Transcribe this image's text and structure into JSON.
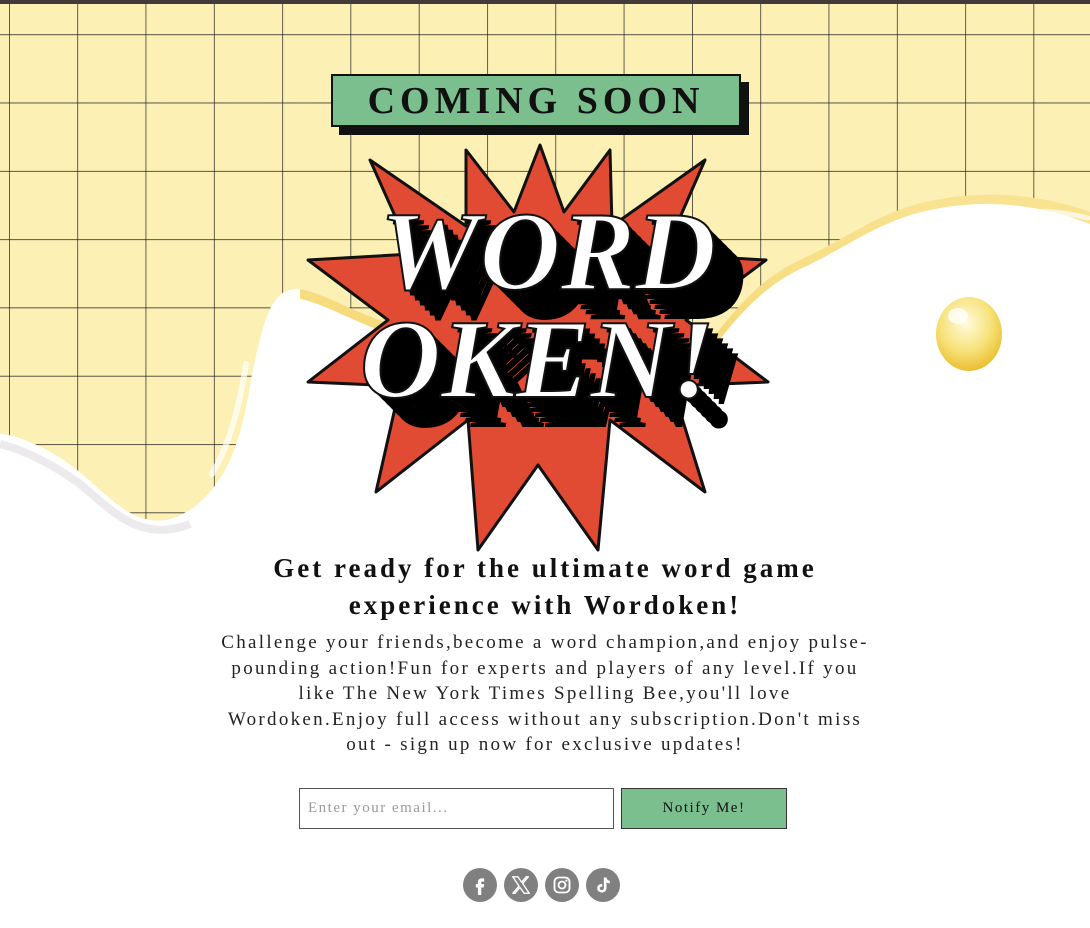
{
  "badge": {
    "label": "COMING SOON"
  },
  "logo": {
    "line1": "WORD",
    "line2": "OKEN!"
  },
  "headline": "Get ready for the ultimate word game experience with Wordoken!",
  "description": "Challenge your friends,become a word champion,and enjoy pulse-pounding action!Fun for experts and players of any level.If you like The New York Times Spelling Bee,you'll love Wordoken.Enjoy full access without any subscription.Don't miss out - sign up now for exclusive updates!",
  "signup": {
    "placeholder": "Enter your email...",
    "button_label": "Notify Me!"
  },
  "socials": [
    {
      "name": "facebook-icon"
    },
    {
      "name": "x-icon"
    },
    {
      "name": "instagram-icon"
    },
    {
      "name": "tiktok-icon"
    }
  ],
  "colors": {
    "accent_green": "#7bbf8e",
    "burst_red": "#e24b33",
    "grid_yellow": "#fdf0b5",
    "icon_gray": "#808080"
  }
}
